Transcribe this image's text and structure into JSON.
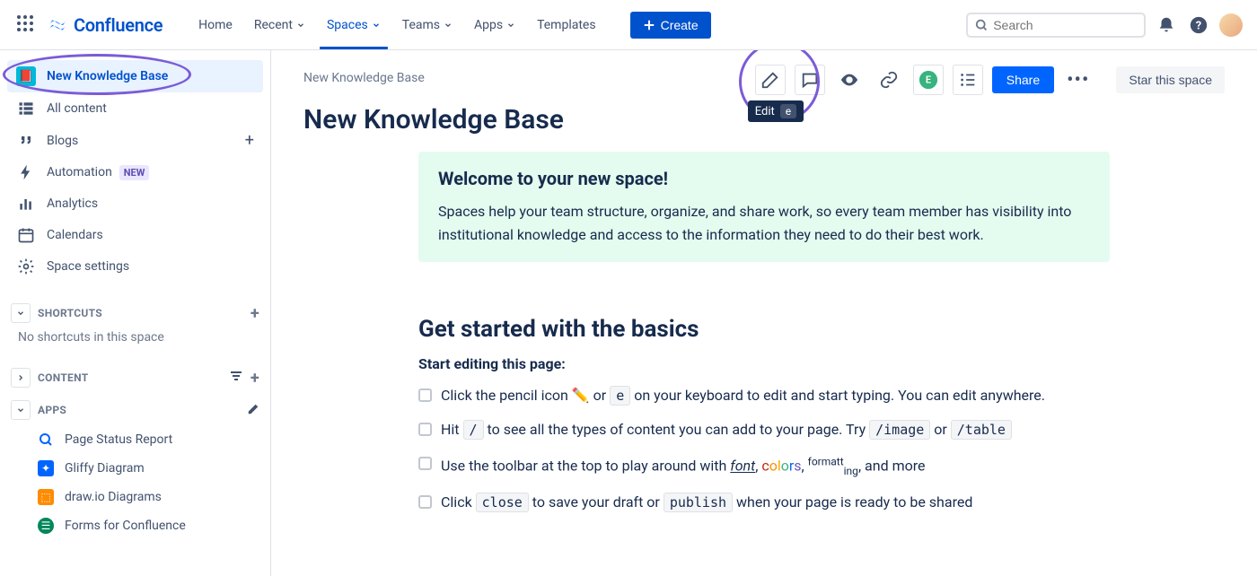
{
  "topnav": {
    "product": "Confluence",
    "items": [
      "Home",
      "Recent",
      "Spaces",
      "Teams",
      "Apps",
      "Templates"
    ],
    "create": "Create",
    "search_placeholder": "Search"
  },
  "sidebar": {
    "space_name": "New Knowledge Base",
    "rows": [
      {
        "label": "All content"
      },
      {
        "label": "Blogs"
      },
      {
        "label": "Automation"
      },
      {
        "label": "Analytics"
      },
      {
        "label": "Calendars"
      },
      {
        "label": "Space settings"
      }
    ],
    "automation_badge": "NEW",
    "shortcuts_header": "SHORTCUTS",
    "shortcuts_empty": "No shortcuts in this space",
    "content_header": "CONTENT",
    "apps_header": "APPS",
    "apps": [
      {
        "label": "Page Status Report"
      },
      {
        "label": "Gliffy Diagram"
      },
      {
        "label": "draw.io Diagrams"
      },
      {
        "label": "Forms for Confluence"
      }
    ]
  },
  "page": {
    "breadcrumb": "New Knowledge Base",
    "title": "New Knowledge Base",
    "edit_tooltip": "Edit",
    "edit_key": "e",
    "share": "Share",
    "star": "Star this space",
    "welcome_heading": "Welcome to your new space!",
    "welcome_body": "Spaces help your team structure, organize, and share work, so every team member has visibility into institutional knowledge and access to the information they need to do their best work.",
    "basics_heading": "Get started with the basics",
    "basics_sub": "Start editing this page:",
    "tasks": {
      "t1a": "Click the pencil icon ",
      "t1_pencil": "✏️",
      "t1b": " or ",
      "t1_key": "e",
      "t1c": " on your keyboard to edit and start typing. You can edit anywhere.",
      "t2a": "Hit ",
      "t2_slash": "/",
      "t2b": " to see all the types of content you can add to your page. Try ",
      "t2_img": "/image",
      "t2c": " or ",
      "t2_tbl": "/table",
      "t3a": "Use the toolbar at the top to play around with ",
      "t3_font": "font",
      "t3_comma1": ", ",
      "t3_colors": {
        "c": "c",
        "o": "o",
        "l": "l",
        "oo": "o",
        "r": "r",
        "s": "s"
      },
      "t3_comma2": ", ",
      "t3_format_a": "formatt",
      "t3_format_b": "ing",
      "t3_end": ", and more",
      "t4a": "Click ",
      "t4_close": "close",
      "t4b": " to save your draft or ",
      "t4_publish": "publish",
      "t4c": " when your page is ready to be shared"
    }
  }
}
